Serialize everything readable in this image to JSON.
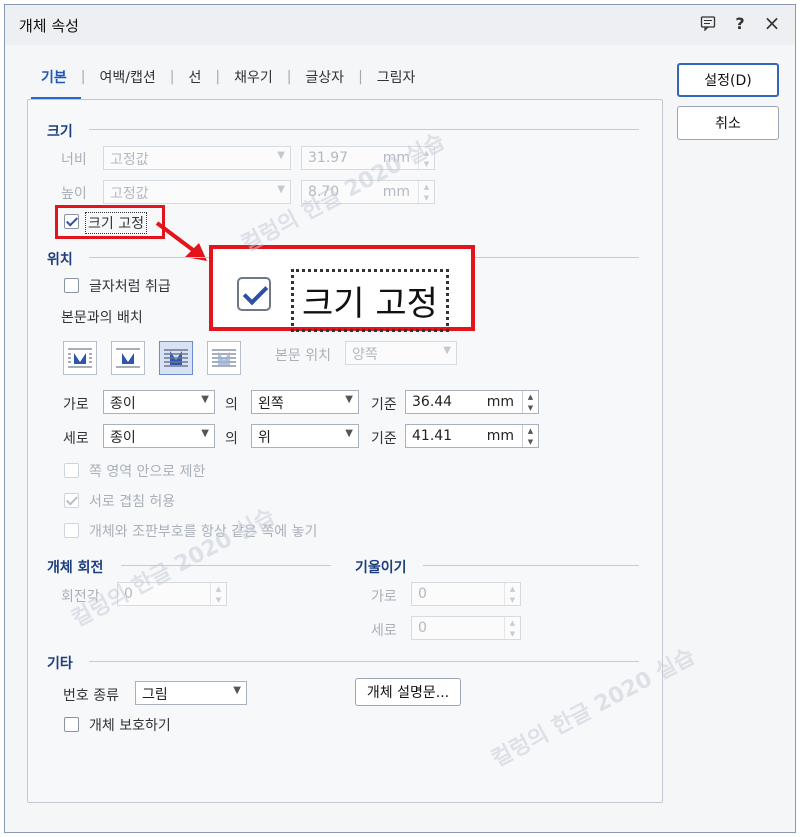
{
  "dialog": {
    "title": "개체 속성",
    "icons": [
      "comment-icon",
      "help-icon",
      "close-icon"
    ],
    "help_glyph": "?",
    "close_glyph": "×"
  },
  "tabs": [
    {
      "label": "기본",
      "active": true
    },
    {
      "label": "여백/캡션"
    },
    {
      "label": "선"
    },
    {
      "label": "채우기"
    },
    {
      "label": "글상자"
    },
    {
      "label": "그림자"
    }
  ],
  "tab_separator": "|",
  "buttons": {
    "ok": "설정(D)",
    "cancel": "취소"
  },
  "size": {
    "title": "크기",
    "width_label": "너비",
    "width_mode": "고정값",
    "width_value": "31.97",
    "width_unit": "mm",
    "height_label": "높이",
    "height_mode": "고정값",
    "height_value": "8.70",
    "height_unit": "mm",
    "lock_label": "크기 고정"
  },
  "position": {
    "title": "위치",
    "treat_as_char": "글자처럼 취급",
    "layout_label": "본문과의 배치",
    "body_pos_label": "본문 위치",
    "body_pos_value": "양쪽",
    "h_label": "가로",
    "h_ref": "종이",
    "h_of": "의",
    "h_align": "왼쪽",
    "h_base": "기준",
    "h_value": "36.44",
    "h_unit": "mm",
    "v_label": "세로",
    "v_ref": "종이",
    "v_of": "의",
    "v_align": "위",
    "v_base": "기준",
    "v_value": "41.41",
    "v_unit": "mm",
    "limit_area": "쪽 영역 안으로 제한",
    "allow_overlap": "서로 겹침 허용",
    "same_page": "개체와 조판부호를 항상 같은 쪽에 놓기"
  },
  "rotation": {
    "title": "개체 회전",
    "angle_label": "회전각",
    "angle_value": "0"
  },
  "skew": {
    "title": "기울이기",
    "h_label": "가로",
    "h_value": "0",
    "v_label": "세로",
    "v_value": "0"
  },
  "other": {
    "title": "기타",
    "number_type_label": "번호 종류",
    "number_type_value": "그림",
    "desc_button": "개체 설명문...",
    "protect_label": "개체 보호하기"
  },
  "callout": {
    "label": "크기 고정"
  },
  "watermark": "컬렁의 한글 2020 실습",
  "colors": {
    "accent": "#2a66c8",
    "highlight": "#e3141b",
    "section": "#1c3f80"
  }
}
